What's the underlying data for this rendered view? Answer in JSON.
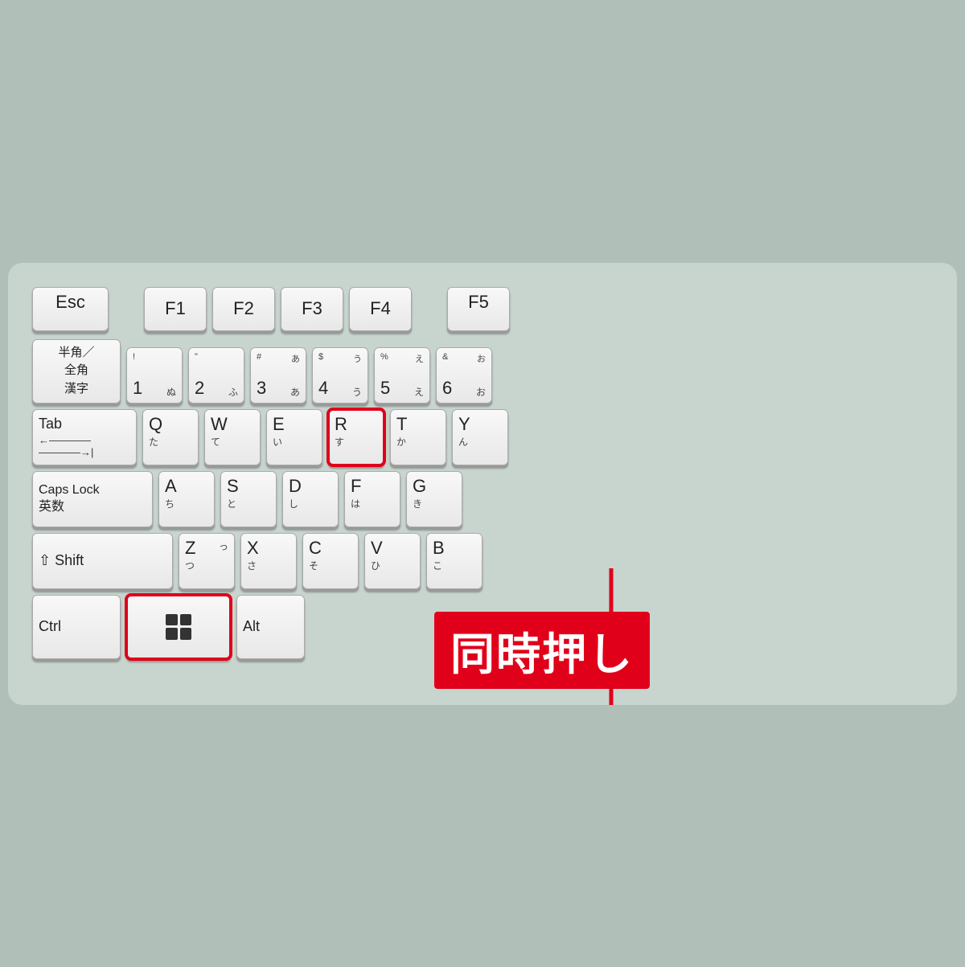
{
  "keyboard": {
    "background": "#c8d4ce",
    "label": "同時押し",
    "highlight_color": "#e0001a",
    "rows": [
      {
        "id": "fkey-row",
        "keys": [
          {
            "id": "esc",
            "main": "Esc",
            "kana": "",
            "type": "esc"
          },
          {
            "id": "gap",
            "type": "gap"
          },
          {
            "id": "f1",
            "main": "F1",
            "kana": "",
            "type": "fkey"
          },
          {
            "id": "f2",
            "main": "F2",
            "kana": "",
            "type": "fkey"
          },
          {
            "id": "f3",
            "main": "F3",
            "kana": "",
            "type": "fkey"
          },
          {
            "id": "f4",
            "main": "F4",
            "kana": "",
            "type": "fkey"
          },
          {
            "id": "gap2",
            "type": "gap"
          },
          {
            "id": "f5",
            "main": "F5",
            "kana": "",
            "type": "fkey"
          }
        ]
      },
      {
        "id": "number-row",
        "keys": [
          {
            "id": "hankaku",
            "main": "半角／\n全角\n漢字",
            "type": "hankaku"
          },
          {
            "id": "1",
            "top_sym": "!",
            "top_kana": "",
            "num": "1",
            "kana": "ぬ"
          },
          {
            "id": "2",
            "top_sym": "\"",
            "top_kana": "",
            "num": "2",
            "kana": "ふ"
          },
          {
            "id": "3",
            "top_sym": "#",
            "top_kana": "あ",
            "num": "3",
            "kana": "あ"
          },
          {
            "id": "4",
            "top_sym": "$",
            "top_kana": "う",
            "num": "4",
            "kana": "う"
          },
          {
            "id": "5",
            "top_sym": "%",
            "top_kana": "え",
            "num": "5",
            "kana": "え"
          },
          {
            "id": "6",
            "top_sym": "&",
            "top_kana": "お",
            "num": "6",
            "kana": "お"
          }
        ]
      },
      {
        "id": "qwerty-row",
        "keys": [
          {
            "id": "tab",
            "type": "tab"
          },
          {
            "id": "q",
            "main": "Q",
            "kana": "た"
          },
          {
            "id": "w",
            "main": "W",
            "kana": "て"
          },
          {
            "id": "e",
            "main": "E",
            "kana": "い"
          },
          {
            "id": "r",
            "main": "R",
            "kana": "す",
            "highlight": true
          },
          {
            "id": "t",
            "main": "T",
            "kana": "か"
          },
          {
            "id": "y",
            "main": "Y",
            "kana": "ん"
          }
        ]
      },
      {
        "id": "asdf-row",
        "keys": [
          {
            "id": "capslock",
            "type": "capslock"
          },
          {
            "id": "a",
            "main": "A",
            "kana": "ち"
          },
          {
            "id": "s",
            "main": "S",
            "kana": "と"
          },
          {
            "id": "d",
            "main": "D",
            "kana": "し"
          },
          {
            "id": "f",
            "main": "F",
            "kana": "は"
          },
          {
            "id": "g",
            "main": "G",
            "kana": "き"
          }
        ]
      },
      {
        "id": "zxcv-row",
        "keys": [
          {
            "id": "shift",
            "type": "shift"
          },
          {
            "id": "z",
            "main": "Z",
            "kana": "っ",
            "sub": "つ"
          },
          {
            "id": "x",
            "main": "X",
            "kana": "さ"
          },
          {
            "id": "c",
            "main": "C",
            "kana": "そ"
          },
          {
            "id": "v",
            "main": "V",
            "kana": "ひ"
          },
          {
            "id": "b",
            "main": "B",
            "kana": "こ"
          }
        ]
      },
      {
        "id": "bottom-row",
        "keys": [
          {
            "id": "ctrl",
            "main": "Ctrl",
            "type": "modifier"
          },
          {
            "id": "win",
            "type": "win",
            "highlight": true
          },
          {
            "id": "alt",
            "main": "Alt",
            "type": "modifier-sm"
          }
        ]
      }
    ]
  }
}
